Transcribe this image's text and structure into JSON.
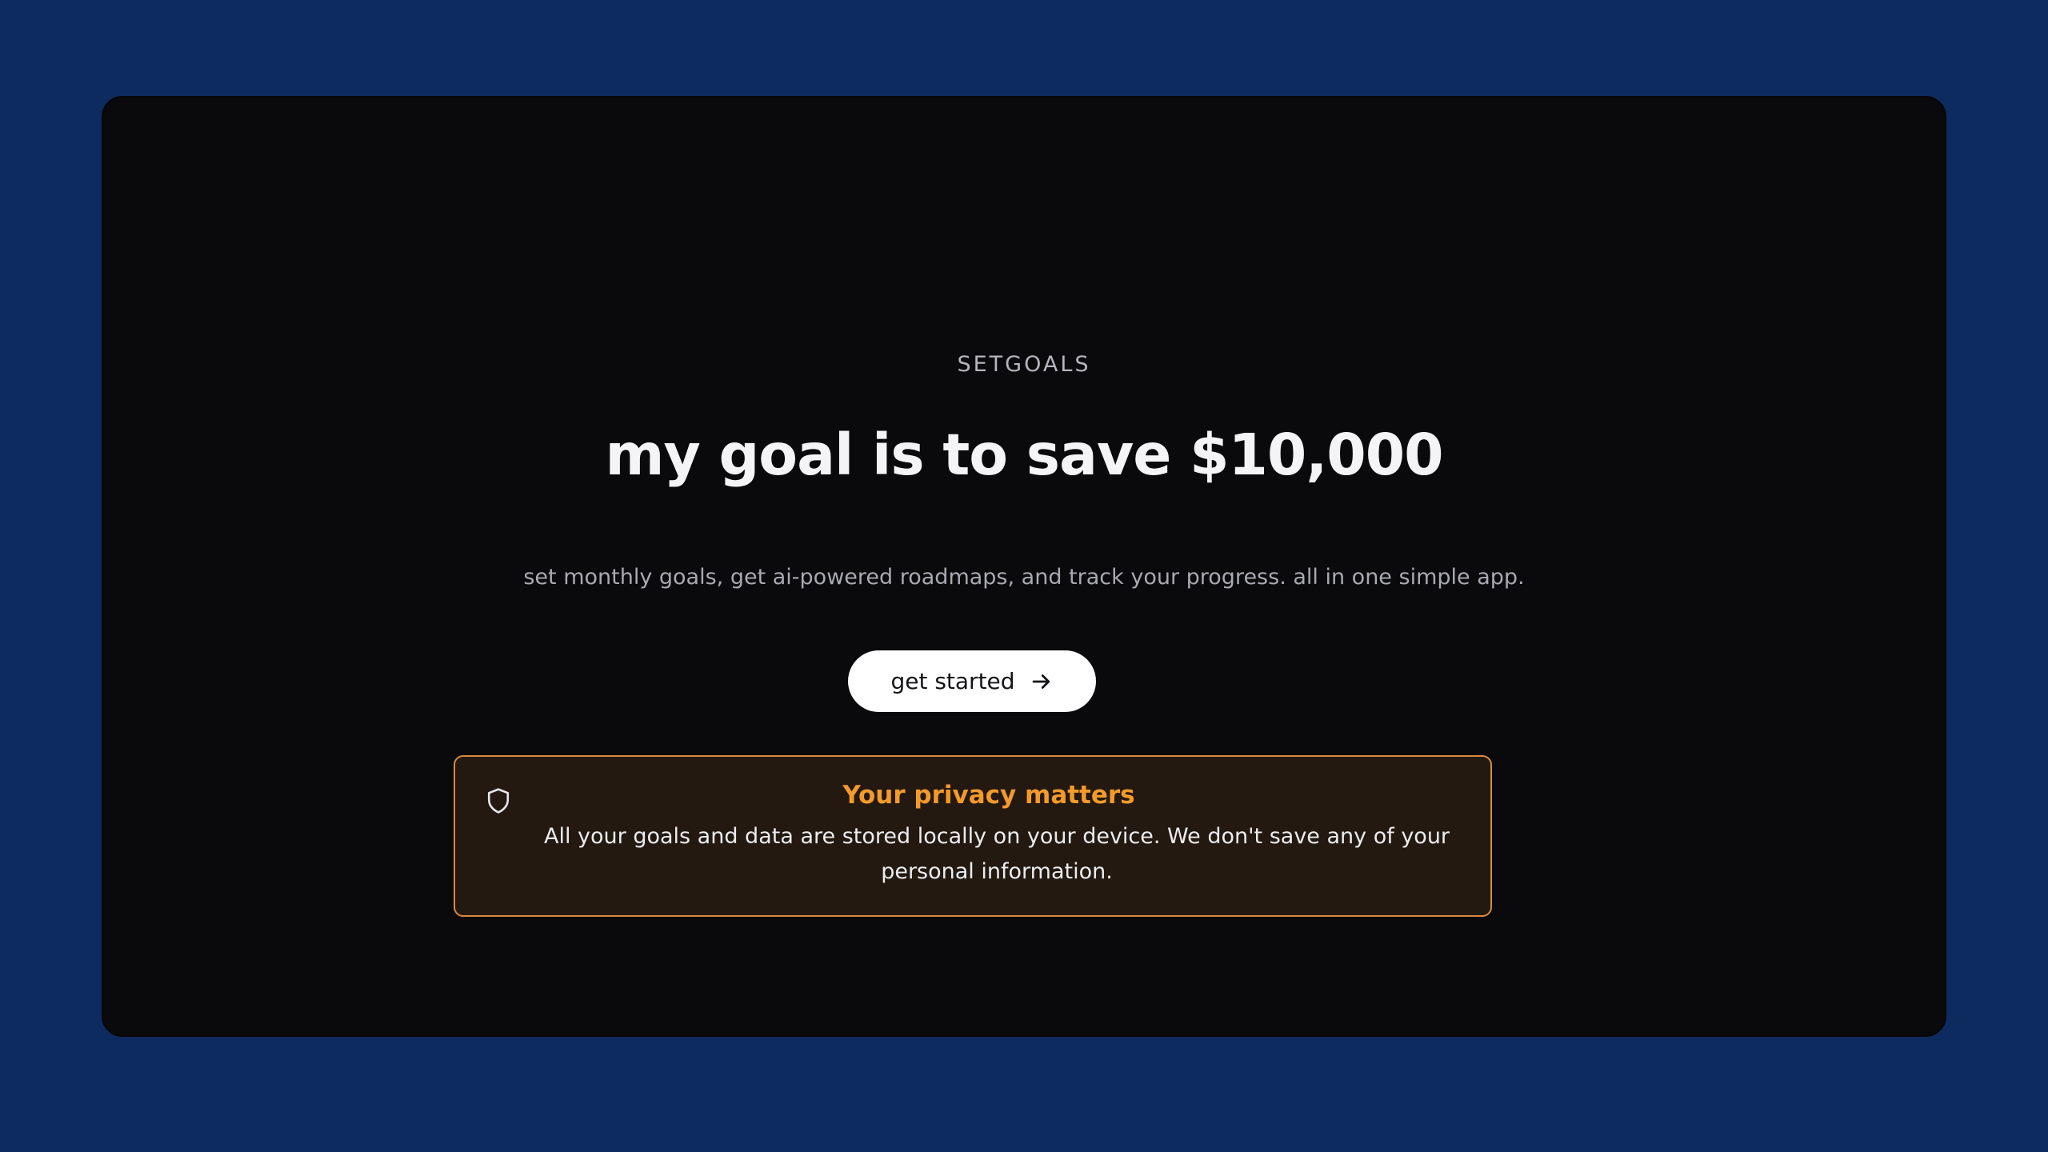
{
  "app": {
    "brand": "SETGOALS"
  },
  "hero": {
    "headline": "my goal is to save $10,000",
    "subtitle": "set monthly goals, get ai-powered roadmaps, and track your progress. all in one simple app.",
    "cta_label": "get started",
    "cta_icon": "arrow-right-icon"
  },
  "privacy": {
    "icon": "shield-icon",
    "title": "Your privacy matters",
    "text": "All your goals and data are stored locally on your device. We don't save any of your personal information."
  },
  "colors": {
    "page_background": "#0e2b5f",
    "window_background": "#0a0a0c",
    "accent_orange": "#f39a2c",
    "privacy_border": "#d68a3e",
    "privacy_background": "#231910",
    "button_background": "#ffffff"
  }
}
